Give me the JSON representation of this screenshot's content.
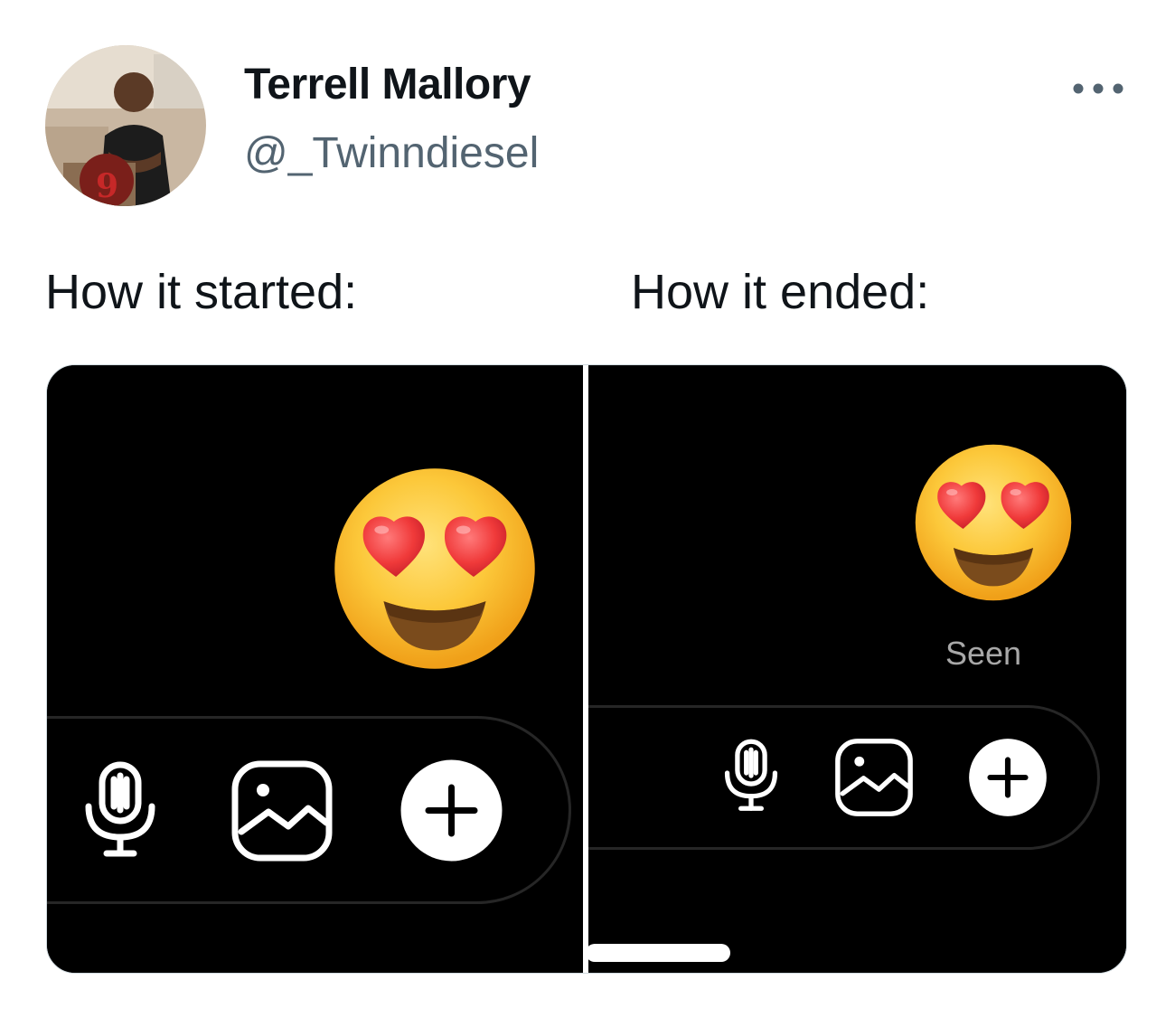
{
  "tweet": {
    "display_name": "Terrell Mallory",
    "handle": "@_Twinndiesel",
    "more_icon": "more-horizontal-icon",
    "text_left": "How it started:",
    "text_right": "How it ended:"
  },
  "media": {
    "left_panel": {
      "emoji": "heart-eyes-emoji",
      "icons": [
        "microphone-icon",
        "image-gallery-icon",
        "plus-icon"
      ]
    },
    "right_panel": {
      "emoji": "heart-eyes-emoji",
      "status": "Seen",
      "icons": [
        "microphone-icon",
        "image-gallery-icon",
        "plus-icon"
      ]
    }
  },
  "colors": {
    "text_primary": "#0f1419",
    "text_secondary": "#536471",
    "media_bg": "#000000",
    "seen_text": "#a8a8a8"
  }
}
